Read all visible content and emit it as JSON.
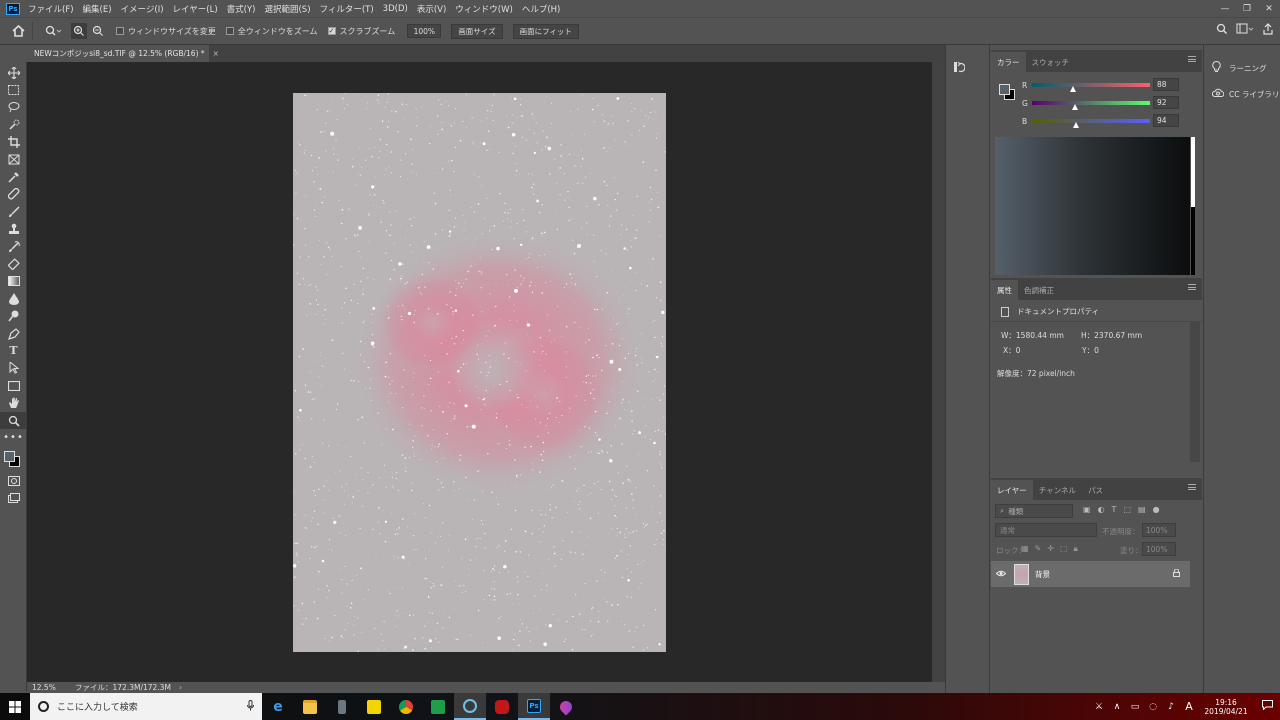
{
  "menu": [
    "ファイル(F)",
    "編集(E)",
    "イメージ(I)",
    "レイヤー(L)",
    "書式(Y)",
    "選択範囲(S)",
    "フィルター(T)",
    "3D(D)",
    "表示(V)",
    "ウィンドウ(W)",
    "ヘルプ(H)"
  ],
  "app_logo": "Ps",
  "options": {
    "resize_windows": "ウィンドウサイズを変更",
    "zoom_all": "全ウィンドウをズーム",
    "scrubby_zoom": "スクラブズーム",
    "zoom_value": "100%",
    "screen_size": "画面サイズ",
    "fit_screen": "画面にフィット"
  },
  "document": {
    "tab_title": "NEWコンポジッsi8_sd.TIF @ 12.5% (RGB/16) *",
    "close": "×"
  },
  "status": {
    "zoom": "12.5%",
    "file": "ファイル：172.3M/172.3M",
    "arrow": "›"
  },
  "color_panel": {
    "tabs": [
      "カラー",
      "スウォッチ"
    ],
    "sliders": [
      {
        "label": "R",
        "value": "88",
        "fraction": 0.345,
        "gradient": "linear-gradient(to right,#005c6b,#ff5c6b)"
      },
      {
        "label": "G",
        "value": "92",
        "fraction": 0.361,
        "gradient": "linear-gradient(to right,#5800 6b,#58ff6b)"
      },
      {
        "label": "B",
        "value": "94",
        "fraction": 0.369,
        "gradient": "linear-gradient(to right,#585c00,#585cff)"
      }
    ],
    "fg_color": "#58626b"
  },
  "properties_panel": {
    "tabs": [
      "属性",
      "色調補正"
    ],
    "header": "ドキュメントプロパティ",
    "width": "W：1580.44 mm",
    "height": "H：2370.67 mm",
    "x": "X：0",
    "y": "Y：0",
    "resolution": "解像度：72 pixel/inch"
  },
  "layers_panel": {
    "tabs": [
      "レイヤー",
      "チャンネル",
      "パス"
    ],
    "filter_placeholder": "種類",
    "blend_mode": "通常",
    "opacity_label": "不透明度：",
    "opacity_value": "100%",
    "lock_label": "ロック：",
    "fill_label": "塗り：",
    "fill_value": "100%",
    "layer_name": "背景"
  },
  "learn_panel": {
    "learn": "ラーニング",
    "libraries": "CC ライブラリ"
  },
  "taskbar": {
    "search_placeholder": "ここに入力して検索",
    "time": "19:16",
    "date": "2019/04/21",
    "ime": "A"
  }
}
